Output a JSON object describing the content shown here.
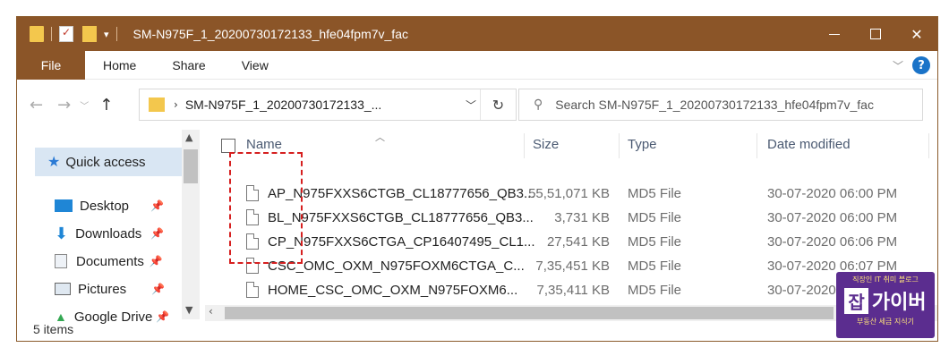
{
  "window": {
    "title": "SM-N975F_1_20200730172133_hfe04fpm7v_fac",
    "quick_access_dropdown": "▾"
  },
  "ribbon": {
    "tabs": [
      "File",
      "Home",
      "Share",
      "View"
    ]
  },
  "address_bar": {
    "path": "SM-N975F_1_20200730172133_...",
    "search_placeholder": "Search SM-N975F_1_20200730172133_hfe04fpm7v_fac"
  },
  "nav_pane": {
    "items": [
      {
        "label": "Quick access",
        "icon": "star-icon"
      },
      {
        "label": "Desktop",
        "icon": "desktop-icon"
      },
      {
        "label": "Downloads",
        "icon": "download-icon"
      },
      {
        "label": "Documents",
        "icon": "document-icon"
      },
      {
        "label": "Pictures",
        "icon": "pictures-icon"
      },
      {
        "label": "Google Drive",
        "icon": "google-drive-icon"
      }
    ]
  },
  "columns": {
    "name": "Name",
    "size": "Size",
    "type": "Type",
    "date": "Date modified"
  },
  "files": [
    {
      "name": "AP_N975FXXS6CTGB_CL18777656_QB3...",
      "size": "55,51,071 KB",
      "type": "MD5 File",
      "date": "30-07-2020 06:00 PM"
    },
    {
      "name": "BL_N975FXXS6CTGB_CL18777656_QB3...",
      "size": "3,731 KB",
      "type": "MD5 File",
      "date": "30-07-2020 06:00 PM"
    },
    {
      "name": "CP_N975FXXS6CTGA_CP16407495_CL1...",
      "size": "27,541 KB",
      "type": "MD5 File",
      "date": "30-07-2020 06:06 PM"
    },
    {
      "name": "CSC_OMC_OXM_N975FOXM6CTGA_C...",
      "size": "7,35,451 KB",
      "type": "MD5 File",
      "date": "30-07-2020 06:07 PM"
    },
    {
      "name": "HOME_CSC_OMC_OXM_N975FOXM6...",
      "size": "7,35,411 KB",
      "type": "MD5 File",
      "date": "30-07-2020 06:06 PM"
    }
  ],
  "status": {
    "count": "5 items"
  },
  "watermark": {
    "top": "직장인 IT 취미 블로그",
    "box": "잡",
    "big": "가이버",
    "bottom": "부동산 세금 지식기"
  },
  "colors": {
    "titlebar": "#8b5528",
    "highlight": "#d62020",
    "watermark": "#5b2d8f"
  }
}
